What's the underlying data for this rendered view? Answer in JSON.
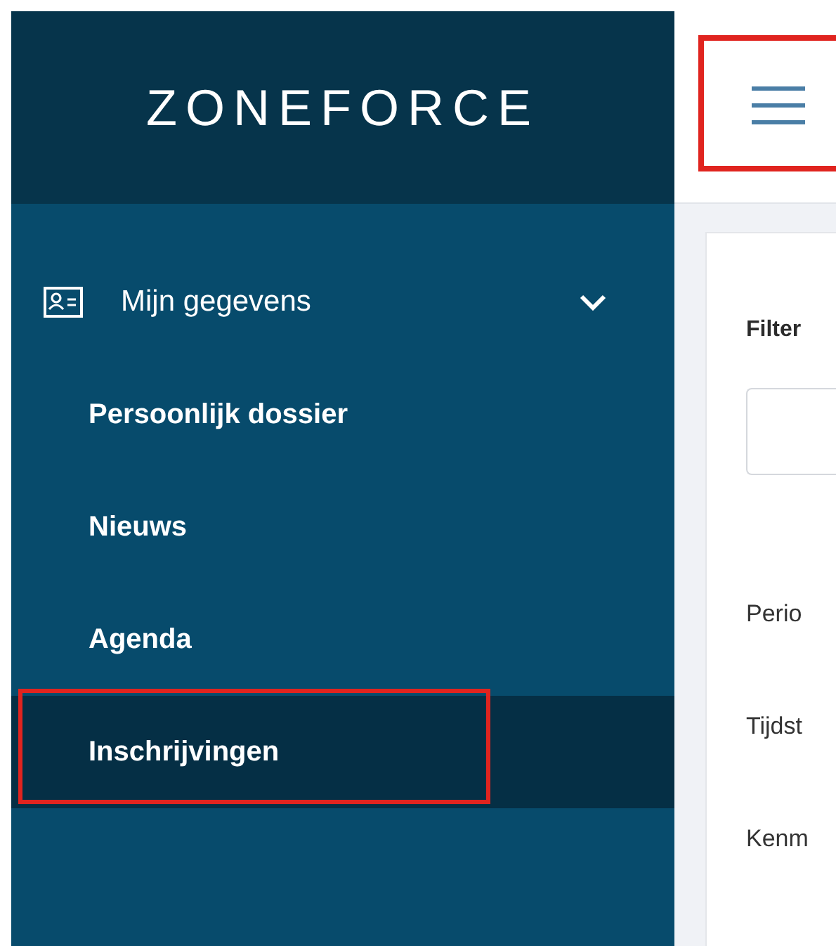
{
  "logo": "ZONEFORCE",
  "sidebar": {
    "group": {
      "label": "Mijn gegevens",
      "expanded": true,
      "items": [
        {
          "label": "Persoonlijk dossier",
          "selected": false,
          "highlighted": false
        },
        {
          "label": "Nieuws",
          "selected": false,
          "highlighted": false
        },
        {
          "label": "Agenda",
          "selected": false,
          "highlighted": false
        },
        {
          "label": "Inschrijvingen",
          "selected": true,
          "highlighted": true
        }
      ]
    }
  },
  "header": {
    "menu_highlighted": true
  },
  "filter": {
    "title": "Filter",
    "labels": [
      "Perio",
      "Tijdst",
      "Kenm"
    ]
  }
}
